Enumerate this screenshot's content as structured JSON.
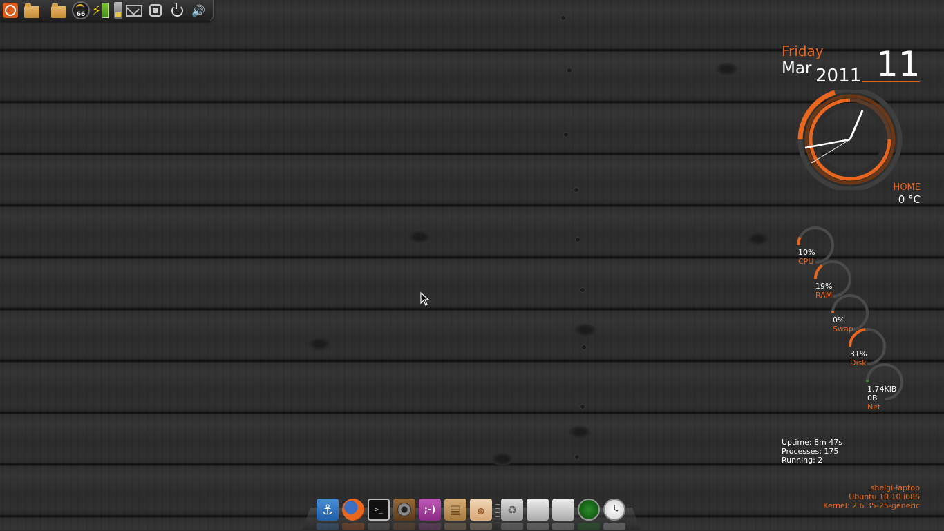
{
  "top_panel": {
    "items": [
      {
        "name": "ubuntu-menu"
      },
      {
        "name": "home-folder"
      },
      {
        "name": "documents-folder"
      },
      {
        "name": "cpu-frequency-gauge",
        "value": "66"
      },
      {
        "name": "power-bolt"
      },
      {
        "name": "battery"
      },
      {
        "name": "system-monitor"
      },
      {
        "name": "mail"
      },
      {
        "name": "chat"
      },
      {
        "name": "power"
      },
      {
        "name": "volume"
      }
    ]
  },
  "date": {
    "weekday": "Friday",
    "month": "Mar",
    "year": "2011",
    "day": "11"
  },
  "weather": {
    "location": "HOME",
    "temperature": "0 °C"
  },
  "monitors": [
    {
      "value": "10%",
      "label": "CPU",
      "level": 0.1
    },
    {
      "value": "19%",
      "label": "RAM",
      "level": 0.19
    },
    {
      "value": "0%",
      "label": "Swap",
      "level": 0.0
    },
    {
      "value": "31%",
      "label": "Disk",
      "level": 0.31
    },
    {
      "value": "1.74KiB",
      "value2": "0B",
      "label": "Net",
      "level": 0.02
    }
  ],
  "stats": {
    "uptime": "Uptime: 8m 47s",
    "processes": "Processes: 175",
    "running": "Running: 2"
  },
  "sysinfo": {
    "hostname": "shelgi-laptop",
    "os": "Ubuntu 10.10  i686",
    "kernel": "Kernel: 2.6.35-25-generic"
  },
  "colors": {
    "accent": "#e8661e",
    "ring_track": "#4a4a4a"
  },
  "dock": {
    "items": [
      "anchor-icon",
      "firefox-icon",
      "terminal-icon",
      "rhythmbox-icon",
      "empathy-icon",
      "software-center-icon",
      "shell-icon",
      "trash-icon",
      "drive-icon",
      "drive-icon",
      "network-icon",
      "clock-icon"
    ]
  }
}
